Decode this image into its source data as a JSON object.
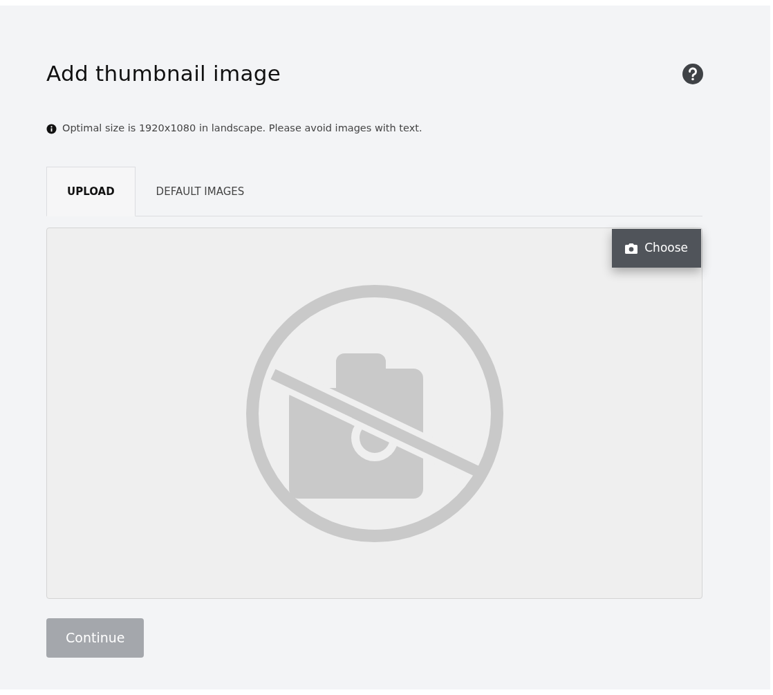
{
  "title": "Add thumbnail image",
  "info": "Optimal size is 1920x1080 in landscape. Please avoid images with text.",
  "tabs": [
    {
      "label": "UPLOAD",
      "selected": true
    },
    {
      "label": "DEFAULT IMAGES",
      "selected": false
    }
  ],
  "upload": {
    "choose_button": "Choose"
  },
  "continue_button": {
    "label": "Continue",
    "disabled": true
  }
}
